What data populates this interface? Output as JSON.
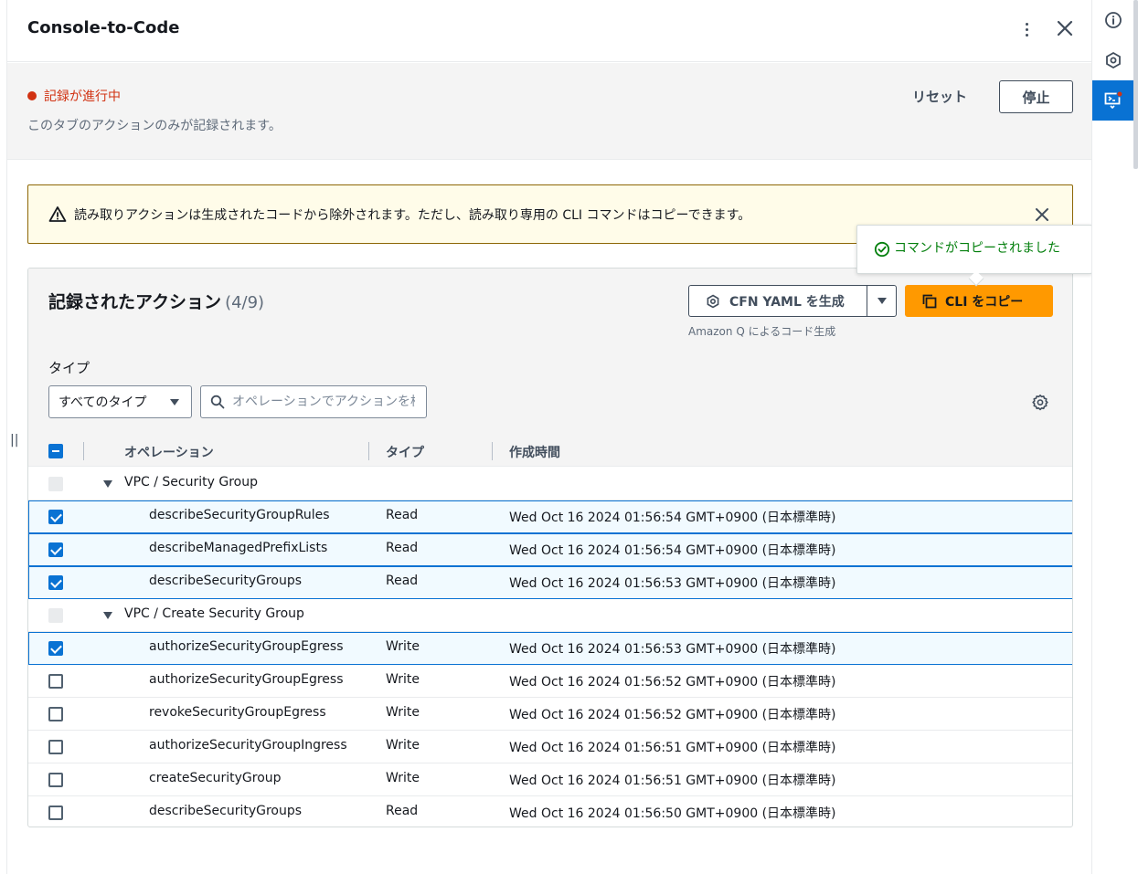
{
  "panel": {
    "title": "Console-to-Code"
  },
  "recording": {
    "status": "記録が進行中",
    "description": "このタブのアクションのみが記録されます。",
    "reset_label": "リセット",
    "stop_label": "停止",
    "status_color": "#d13212"
  },
  "warning": {
    "text": "読み取りアクションは生成されたコードから除外されます。ただし、読み取り専用の CLI コマンドはコピーできます。"
  },
  "toast": {
    "text": "コマンドがコピーされました"
  },
  "actions": {
    "title": "記録されたアクション",
    "count": "(4/9)",
    "cfn_button": "CFN YAML を生成",
    "cli_button": "CLI をコピー",
    "amazonq_note": "Amazon Q によるコード生成",
    "type_label": "タイプ",
    "type_select": "すべてのタイプ",
    "search_placeholder": "オペレーションでアクションを検索",
    "accent_color": "#ff9900"
  },
  "table": {
    "columns": [
      "オペレーション",
      "タイプ",
      "作成時間"
    ],
    "groups": [
      {
        "label": "VPC / Security Group",
        "rows": [
          {
            "op": "describeSecurityGroupRules",
            "type": "Read",
            "time": "Wed Oct 16 2024 01:56:54 GMT+0900 (日本標準時)",
            "checked": true
          },
          {
            "op": "describeManagedPrefixLists",
            "type": "Read",
            "time": "Wed Oct 16 2024 01:56:54 GMT+0900 (日本標準時)",
            "checked": true
          },
          {
            "op": "describeSecurityGroups",
            "type": "Read",
            "time": "Wed Oct 16 2024 01:56:53 GMT+0900 (日本標準時)",
            "checked": true
          }
        ]
      },
      {
        "label": "VPC / Create Security Group",
        "rows": [
          {
            "op": "authorizeSecurityGroupEgress",
            "type": "Write",
            "time": "Wed Oct 16 2024 01:56:53 GMT+0900 (日本標準時)",
            "checked": true
          },
          {
            "op": "authorizeSecurityGroupEgress",
            "type": "Write",
            "time": "Wed Oct 16 2024 01:56:52 GMT+0900 (日本標準時)",
            "checked": false
          },
          {
            "op": "revokeSecurityGroupEgress",
            "type": "Write",
            "time": "Wed Oct 16 2024 01:56:52 GMT+0900 (日本標準時)",
            "checked": false
          },
          {
            "op": "authorizeSecurityGroupIngress",
            "type": "Write",
            "time": "Wed Oct 16 2024 01:56:51 GMT+0900 (日本標準時)",
            "checked": false
          },
          {
            "op": "createSecurityGroup",
            "type": "Write",
            "time": "Wed Oct 16 2024 01:56:51 GMT+0900 (日本標準時)",
            "checked": false
          },
          {
            "op": "describeSecurityGroups",
            "type": "Read",
            "time": "Wed Oct 16 2024 01:56:50 GMT+0900 (日本標準時)",
            "checked": false
          }
        ]
      }
    ]
  },
  "rail": {
    "items": [
      {
        "icon": "info-icon",
        "active": false
      },
      {
        "icon": "amazon-q-icon",
        "active": false
      },
      {
        "icon": "console-to-code-icon",
        "active": true
      }
    ],
    "active_color": "#0972d3"
  }
}
